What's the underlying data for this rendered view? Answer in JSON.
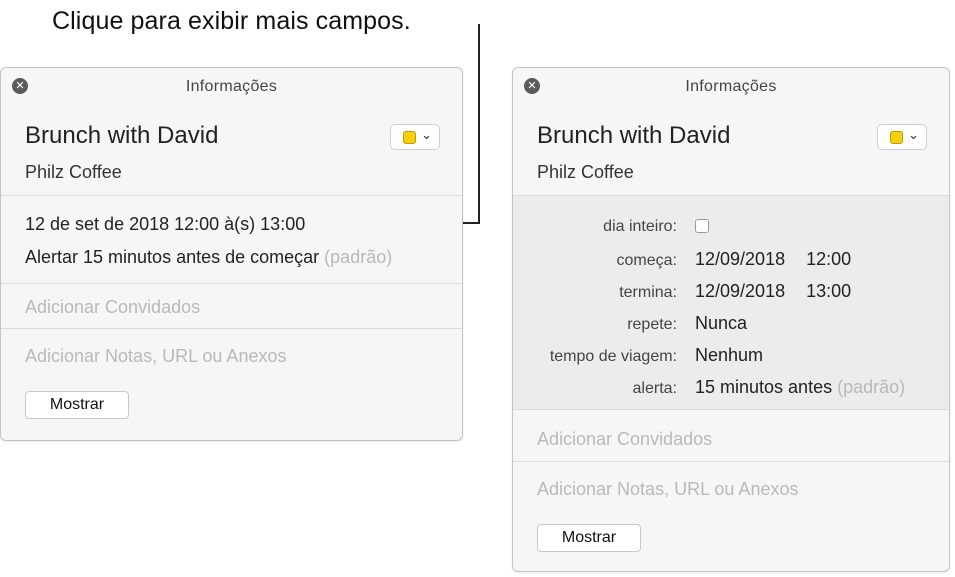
{
  "callout": "Clique para exibir mais campos.",
  "left_panel": {
    "title": "Informações",
    "event_title": "Brunch with David",
    "location": "Philz Coffee",
    "date_time": "12 de set de 2018  12:00 à(s) 13:00",
    "alert": "Alertar 15 minutos antes de começar",
    "alert_default": "(padrão)",
    "add_invitees": "Adicionar Convidados",
    "add_notes": "Adicionar Notas, URL ou Anexos",
    "show_button": "Mostrar",
    "color": "#f6d10b"
  },
  "right_panel": {
    "title": "Informações",
    "event_title": "Brunch with David",
    "location": "Philz Coffee",
    "all_day_label": "dia inteiro:",
    "all_day_checked": false,
    "starts_label": "começa:",
    "starts_date": "12/09/2018",
    "starts_time": "12:00",
    "ends_label": "termina:",
    "ends_date": "12/09/2018",
    "ends_time": "13:00",
    "repeat_label": "repete:",
    "repeat_value": "Nunca",
    "travel_label": "tempo de viagem:",
    "travel_value": "Nenhum",
    "alert_label": "alerta:",
    "alert_value": "15 minutos antes",
    "alert_default": "(padrão)",
    "add_invitees": "Adicionar Convidados",
    "add_notes": "Adicionar Notas, URL ou Anexos",
    "show_button": "Mostrar",
    "color": "#f6d10b"
  }
}
